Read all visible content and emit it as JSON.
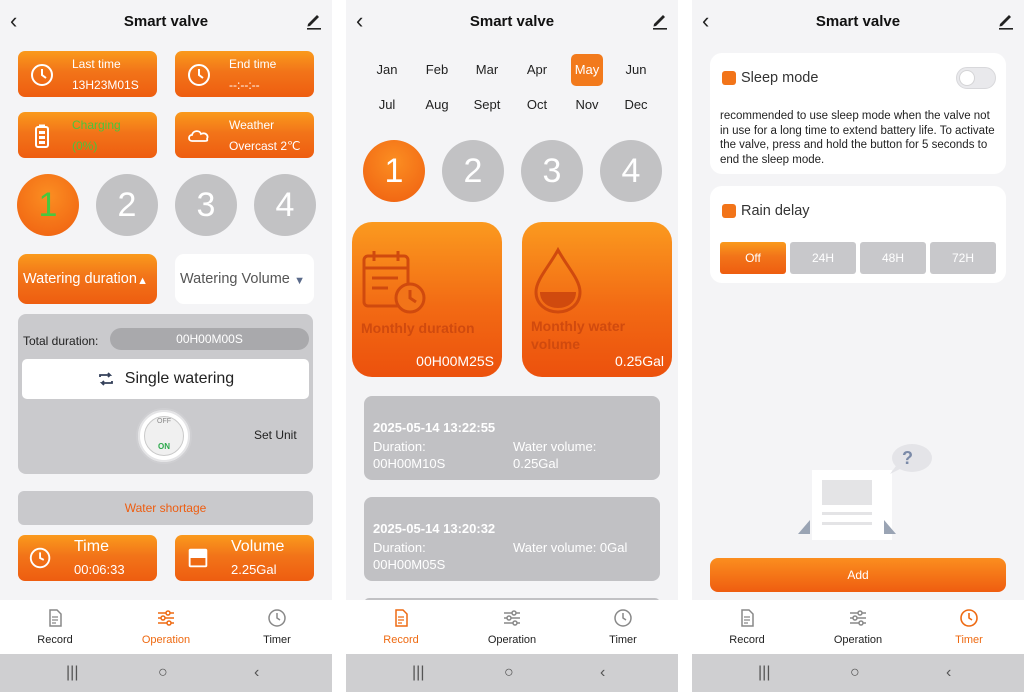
{
  "header": {
    "title": "Smart valve"
  },
  "panel1": {
    "last_time": {
      "label": "Last time",
      "value": "13H23M01S"
    },
    "end_time": {
      "label": "End time",
      "value": "--:--:--"
    },
    "battery": {
      "label": "Charging",
      "value": "(0%)"
    },
    "weather": {
      "label": "Weather",
      "value": "Overcast 2℃"
    },
    "zones": [
      "1",
      "2",
      "3",
      "4"
    ],
    "watering_duration_label": "Watering duration",
    "watering_volume_label": "Watering Volume",
    "total_duration_label": "Total duration:",
    "total_duration_value": "00H00M00S",
    "single_watering_label": "Single watering",
    "toggle_off": "OFF",
    "toggle_on": "ON",
    "set_unit_label": "Set Unit",
    "water_shortage_label": "Water shortage",
    "time": {
      "label": "Time",
      "value": "00:06:33"
    },
    "volume": {
      "label": "Volume",
      "value": "2.25Gal"
    }
  },
  "panel2": {
    "months": [
      "Jan",
      "Feb",
      "Mar",
      "Apr",
      "May",
      "Jun",
      "Jul",
      "Aug",
      "Sept",
      "Oct",
      "Nov",
      "Dec"
    ],
    "selected_month": "May",
    "zones": [
      "1",
      "2",
      "3",
      "4"
    ],
    "monthly_duration": {
      "label": "Monthly duration",
      "value": "00H00M25S"
    },
    "monthly_volume": {
      "label_line1": "Monthly water",
      "label_line2": "volume",
      "value": "0.25Gal"
    },
    "records": [
      {
        "timestamp": "2025-05-14 13:22:55",
        "duration_label": "Duration:",
        "duration": "00H00M10S",
        "volume_label": "Water volume:",
        "volume": "0.25Gal"
      },
      {
        "timestamp": "2025-05-14 13:20:32",
        "duration_label": "Duration:",
        "duration": "00H00M05S",
        "volume_label": "Water volume: 0Gal",
        "volume": ""
      }
    ]
  },
  "panel3": {
    "sleep_mode_label": "Sleep mode",
    "sleep_mode_description": "recommended to use sleep mode when the valve not in use for a long time to extend battery life. To activate the valve, press and hold the button for 5 seconds to end the sleep mode.",
    "rain_delay_label": "Rain delay",
    "rain_delay_options": [
      "Off",
      "24H",
      "48H",
      "72H"
    ],
    "rain_delay_selected": "Off",
    "empty_help_glyph": "?",
    "add_label": "Add"
  },
  "nav": {
    "record": "Record",
    "operation": "Operation",
    "timer": "Timer"
  },
  "colors": {
    "accent": "#f27419",
    "accent_dark": "#ee5d10",
    "gray_tile": "#c2c2c4",
    "background": "#f4f4f6"
  }
}
